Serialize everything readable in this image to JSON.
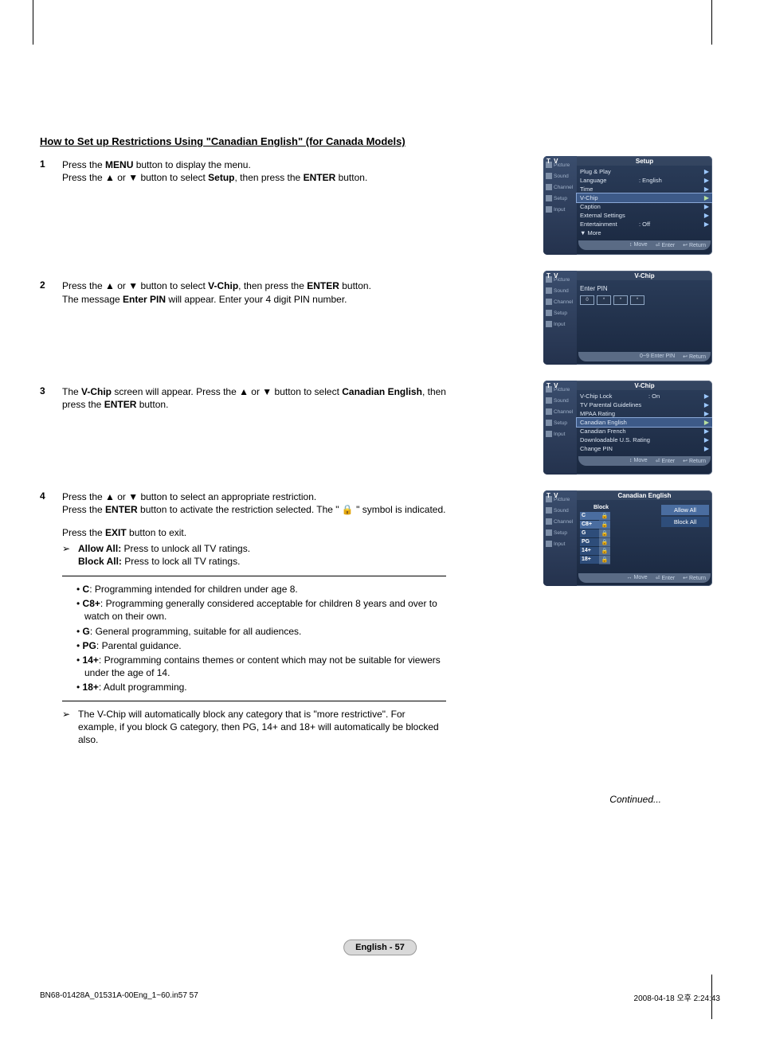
{
  "header": {
    "title": "How to Set up Restrictions Using \"Canadian English\" (for Canada Models)"
  },
  "steps": [
    {
      "num": "1",
      "lines": [
        "Press the <b>MENU</b> button to display the menu.",
        "Press the ▲ or ▼ button to select <b>Setup</b>, then press the <b>ENTER</b> button."
      ]
    },
    {
      "num": "2",
      "lines": [
        "Press the ▲ or ▼ button to select <b>V-Chip</b>, then press the <b>ENTER</b> button.",
        "The message <b>Enter PIN</b> will appear. Enter your 4 digit PIN number."
      ]
    },
    {
      "num": "3",
      "lines": [
        "The <b>V-Chip</b> screen will appear. Press the ▲ or ▼ button to select <b>Canadian English</b>, then press the <b>ENTER</b> button."
      ]
    },
    {
      "num": "4",
      "lines": [
        "Press the ▲ or ▼ button to select an appropriate restriction.",
        "Press the <b>ENTER</b> button to activate the restriction selected. The \" 🔒 \" symbol is indicated."
      ],
      "exit_line": "Press the <b>EXIT</b> button to exit.",
      "allow_all": "<b>Allow All:</b> Press to unlock all TV ratings.",
      "block_all": "<b>Block All:</b> Press to lock all TV ratings.",
      "ratings": [
        {
          "code": "C",
          "desc": "Programming intended for children under age 8."
        },
        {
          "code": "C8+",
          "desc": "Programming generally considered acceptable for children 8 years and over to watch on their own."
        },
        {
          "code": "G",
          "desc": "General programming, suitable for all audiences."
        },
        {
          "code": "PG",
          "desc": "Parental guidance."
        },
        {
          "code": "14+",
          "desc": "Programming contains themes or content which may not be suitable for viewers under the age of 14."
        },
        {
          "code": "18+",
          "desc": "Adult programming."
        }
      ],
      "auto_block": "The V-Chip will automatically block any category that is \"more restrictive\". For example, if you block G category, then PG, 14+ and 18+ will automatically be blocked also."
    }
  ],
  "continued": "Continued...",
  "page_pill": "English - 57",
  "footer": {
    "left": "BN68-01428A_01531A-00Eng_1~60.in57   57",
    "right": "2008-04-18   오후 2:24:43"
  },
  "osd_common": {
    "tv": "T V",
    "side_tabs": [
      "Picture",
      "Sound",
      "Channel",
      "Setup",
      "Input"
    ],
    "footer_move": "Move",
    "footer_enter": "Enter",
    "footer_return": "Return",
    "footer_enter_pin": "Enter PIN",
    "footer_arrows_lr": "↔",
    "footer_arrows_ud": "↕",
    "footer_09": "0~9"
  },
  "osd1": {
    "title": "Setup",
    "items": [
      {
        "label": "Plug & Play",
        "val": ""
      },
      {
        "label": "Language",
        "val": ": English"
      },
      {
        "label": "Time",
        "val": ""
      },
      {
        "label": "V-Chip",
        "val": "",
        "sel": true
      },
      {
        "label": "Caption",
        "val": ""
      },
      {
        "label": "External Settings",
        "val": ""
      },
      {
        "label": "Entertainment",
        "val": ": Off"
      },
      {
        "label": "▼ More",
        "val": ""
      }
    ]
  },
  "osd2": {
    "title": "V-Chip",
    "enter_pin": "Enter PIN",
    "pins": [
      "0",
      "*",
      "*",
      "*"
    ]
  },
  "osd3": {
    "title": "V-Chip",
    "items": [
      {
        "label": "V-Chip Lock",
        "val": ": On"
      },
      {
        "label": "TV Parental Guidelines",
        "val": ""
      },
      {
        "label": "MPAA Rating",
        "val": ""
      },
      {
        "label": "Canadian English",
        "val": "",
        "sel": true
      },
      {
        "label": "Canadian French",
        "val": ""
      },
      {
        "label": "Downloadable U.S. Rating",
        "val": ""
      },
      {
        "label": "Change PIN",
        "val": ""
      }
    ]
  },
  "osd4": {
    "title": "Canadian English",
    "block_head": "Block",
    "rows": [
      "C",
      "C8+",
      "G",
      "PG",
      "14+",
      "18+"
    ],
    "allow_all": "Allow All",
    "block_all": "Block All",
    "lock_glyph": "🔒"
  }
}
